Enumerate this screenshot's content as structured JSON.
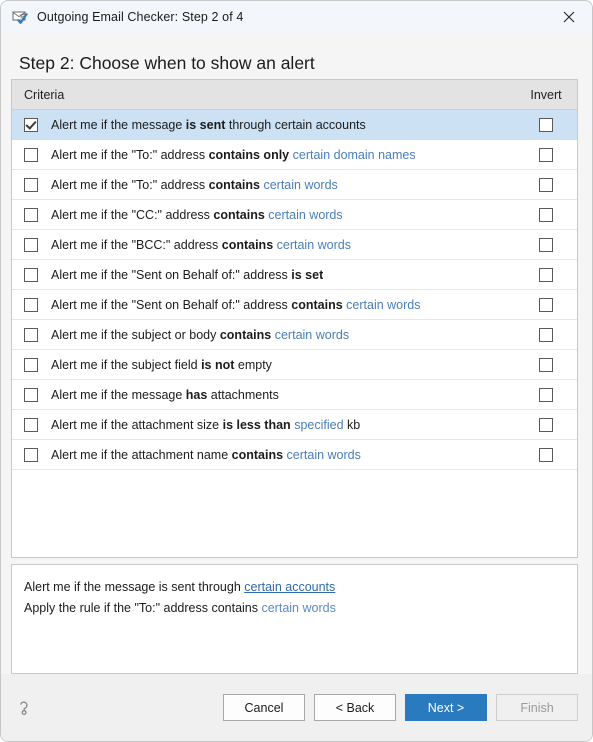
{
  "window": {
    "title": "Outgoing Email Checker: Step 2 of 4",
    "icon": "email-check-icon",
    "close_label": "✕"
  },
  "heading": "Step 2: Choose when to show an alert",
  "list": {
    "columns": {
      "criteria": "Criteria",
      "invert": "Invert"
    },
    "rows": [
      {
        "checked": true,
        "selected": true,
        "invert": false,
        "parts": [
          {
            "t": "Alert me if the message ",
            "s": "plain"
          },
          {
            "t": "is sent",
            "s": "bold"
          },
          {
            "t": " through certain accounts",
            "s": "plain"
          }
        ]
      },
      {
        "checked": false,
        "selected": false,
        "invert": false,
        "parts": [
          {
            "t": "Alert me if the \"To:\" address ",
            "s": "plain"
          },
          {
            "t": "contains only",
            "s": "bold"
          },
          {
            "t": " ",
            "s": "plain"
          },
          {
            "t": "certain domain names",
            "s": "link"
          }
        ]
      },
      {
        "checked": false,
        "selected": false,
        "invert": false,
        "parts": [
          {
            "t": "Alert me if the \"To:\" address ",
            "s": "plain"
          },
          {
            "t": "contains",
            "s": "bold"
          },
          {
            "t": " ",
            "s": "plain"
          },
          {
            "t": "certain words",
            "s": "link"
          }
        ]
      },
      {
        "checked": false,
        "selected": false,
        "invert": false,
        "parts": [
          {
            "t": "Alert me if the \"CC:\" address ",
            "s": "plain"
          },
          {
            "t": "contains",
            "s": "bold"
          },
          {
            "t": " ",
            "s": "plain"
          },
          {
            "t": "certain words",
            "s": "link"
          }
        ]
      },
      {
        "checked": false,
        "selected": false,
        "invert": false,
        "parts": [
          {
            "t": "Alert me if the \"BCC:\" address ",
            "s": "plain"
          },
          {
            "t": "contains",
            "s": "bold"
          },
          {
            "t": " ",
            "s": "plain"
          },
          {
            "t": "certain words",
            "s": "link"
          }
        ]
      },
      {
        "checked": false,
        "selected": false,
        "invert": false,
        "parts": [
          {
            "t": "Alert me if the \"Sent on Behalf of:\" address ",
            "s": "plain"
          },
          {
            "t": "is set",
            "s": "bold"
          }
        ]
      },
      {
        "checked": false,
        "selected": false,
        "invert": false,
        "parts": [
          {
            "t": "Alert me if the \"Sent on Behalf of:\" address ",
            "s": "plain"
          },
          {
            "t": "contains",
            "s": "bold"
          },
          {
            "t": " ",
            "s": "plain"
          },
          {
            "t": "certain words",
            "s": "link"
          }
        ]
      },
      {
        "checked": false,
        "selected": false,
        "invert": false,
        "parts": [
          {
            "t": "Alert me if the subject or body ",
            "s": "plain"
          },
          {
            "t": "contains",
            "s": "bold"
          },
          {
            "t": " ",
            "s": "plain"
          },
          {
            "t": "certain words",
            "s": "link"
          }
        ]
      },
      {
        "checked": false,
        "selected": false,
        "invert": false,
        "parts": [
          {
            "t": "Alert me if the subject field ",
            "s": "plain"
          },
          {
            "t": "is not",
            "s": "bold"
          },
          {
            "t": " empty",
            "s": "plain"
          }
        ]
      },
      {
        "checked": false,
        "selected": false,
        "invert": false,
        "parts": [
          {
            "t": "Alert me if the message ",
            "s": "plain"
          },
          {
            "t": "has",
            "s": "bold"
          },
          {
            "t": " attachments",
            "s": "plain"
          }
        ]
      },
      {
        "checked": false,
        "selected": false,
        "invert": false,
        "parts": [
          {
            "t": "Alert me if the attachment size ",
            "s": "plain"
          },
          {
            "t": "is less than",
            "s": "bold"
          },
          {
            "t": " ",
            "s": "plain"
          },
          {
            "t": "specified",
            "s": "link"
          },
          {
            "t": " kb",
            "s": "plain"
          }
        ]
      },
      {
        "checked": false,
        "selected": false,
        "invert": false,
        "parts": [
          {
            "t": "Alert me if the attachment name ",
            "s": "plain"
          },
          {
            "t": "contains",
            "s": "bold"
          },
          {
            "t": " ",
            "s": "plain"
          },
          {
            "t": "certain words",
            "s": "link"
          }
        ]
      }
    ]
  },
  "summary": {
    "lines": [
      [
        {
          "t": "Alert me if the message is sent through ",
          "s": "plain"
        },
        {
          "t": "certain accounts",
          "s": "link-underline"
        }
      ],
      [
        {
          "t": "Apply the rule if the \"To:\" address contains ",
          "s": "plain"
        },
        {
          "t": "certain words",
          "s": "link"
        }
      ]
    ]
  },
  "footer": {
    "help_icon": "question-mark-icon",
    "buttons": [
      {
        "label": "Cancel",
        "style": "normal",
        "name": "cancel-button"
      },
      {
        "label": "< Back",
        "style": "normal",
        "name": "back-button"
      },
      {
        "label": "Next >",
        "style": "primary",
        "name": "next-button"
      },
      {
        "label": "Finish",
        "style": "disabled",
        "name": "finish-button"
      }
    ]
  },
  "colors": {
    "accent": "#2a7ac0",
    "link": "#4a7ebb",
    "selected_row": "#cce2f4",
    "header_row": "#e3e3e3",
    "titlebar": "#f3f6fb"
  }
}
